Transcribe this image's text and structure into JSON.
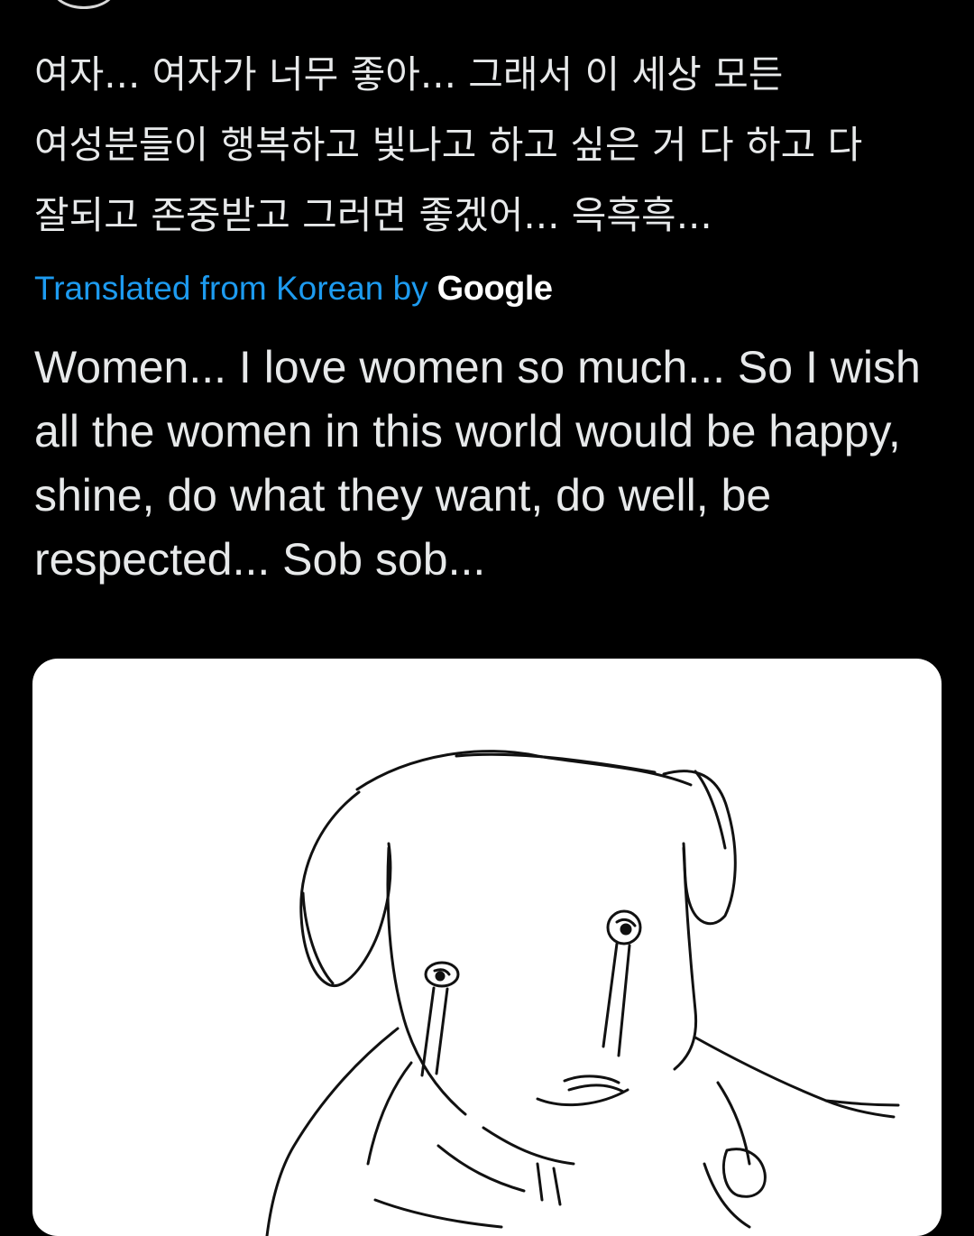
{
  "tweet": {
    "original_text": "여자... 여자가 너무 좋아... 그래서 이 세상 모든 여성분들이 행복하고 빛나고 하고 싶은 거 다 하고 다 잘되고 존중받고 그러면 좋겠어... 윽흑흑...",
    "translation_label": "Translated from Korean by",
    "translation_provider": "Google",
    "translated_text": "Women... I love women so much... So I wish all the women in this world would be happy, shine, do what they want, do well, be respected... Sob sob...",
    "media": {
      "description_icon": "crying-puppy-drawing"
    }
  },
  "colors": {
    "background": "#000000",
    "text": "#e7e9ea",
    "link": "#1d9bf0",
    "media_background": "#ffffff"
  }
}
